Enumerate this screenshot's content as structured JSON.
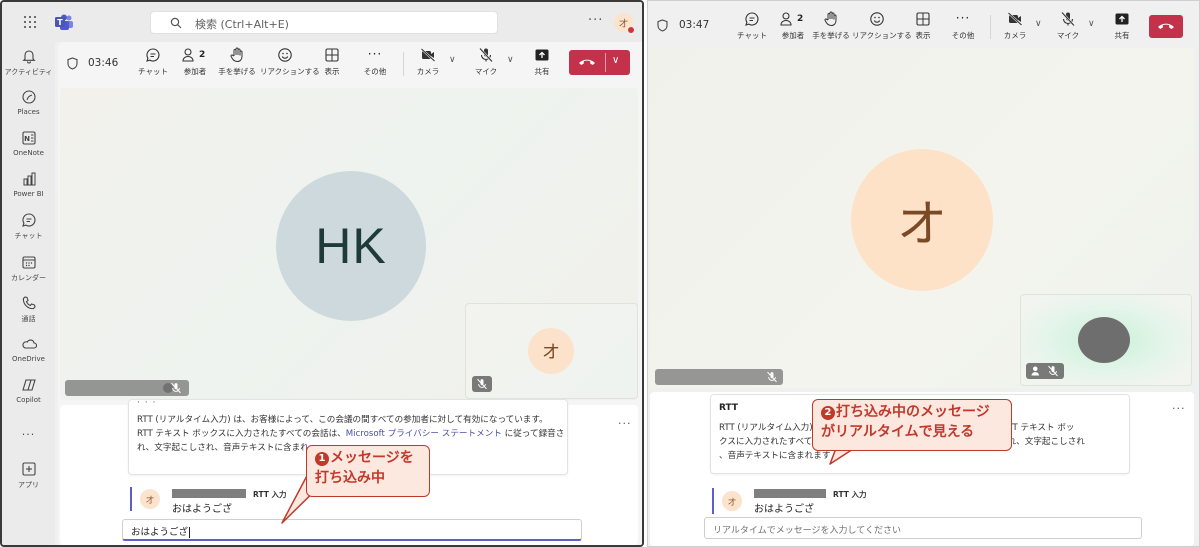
{
  "left": {
    "search_placeholder": "検索 (Ctrl+Alt+E)",
    "top_more": "···",
    "top_avatar": "オ",
    "rail": [
      {
        "label": "アクティビティ",
        "icon": "bell-icon"
      },
      {
        "label": "Places",
        "icon": "places-icon"
      },
      {
        "label": "OneNote",
        "icon": "onenote-icon"
      },
      {
        "label": "Power BI",
        "icon": "powerbi-icon"
      },
      {
        "label": "チャット",
        "icon": "chat-icon"
      },
      {
        "label": "カレンダー",
        "icon": "calendar-icon"
      },
      {
        "label": "通話",
        "icon": "phone-icon"
      },
      {
        "label": "OneDrive",
        "icon": "onedrive-icon"
      },
      {
        "label": "Copilot",
        "icon": "copilot-icon"
      },
      {
        "label": "···",
        "icon": "more-icon"
      },
      {
        "label": "アプリ",
        "icon": "apps-icon"
      }
    ],
    "timer": "03:46",
    "toolbar": {
      "chat": "チャット",
      "participants": "参加者",
      "participants_count": "2",
      "raise_hand": "手を挙げる",
      "reactions": "リアクションする",
      "view": "表示",
      "more": "その他",
      "camera": "カメラ",
      "mic": "マイク",
      "share": "共有"
    },
    "main_avatar": "HK",
    "pip_avatar": "オ",
    "info_text_1": "RTT (リアルタイム入力) は、お客様によって、この会議の間すべての参加者に対して有効になっています。",
    "info_text_2a": "RTT テキスト ボックスに入力されたすべての会話は、",
    "info_link": "Microsoft プライバシー ステートメント",
    "info_text_2b": " に従って録音さ",
    "info_text_3": "れ、文字起こしされ、音声テキストに含まれ",
    "panel_more": "···",
    "rtt_avatar": "オ",
    "rtt_label": "RTT 入力",
    "rtt_message": "おはようござ",
    "input_value": "おはようござ"
  },
  "callout1": {
    "num": "1",
    "line1": "メッセージを",
    "line2": "打ち込み中"
  },
  "callout2": {
    "num": "2",
    "line1": "打ち込み中のメッセージ",
    "line2": "がリアルタイムで見える"
  },
  "right": {
    "timer": "03:47",
    "toolbar": {
      "chat": "チャット",
      "participants": "参加者",
      "participants_count": "2",
      "raise_hand": "手を挙げる",
      "reactions": "リアクションする",
      "view": "表示",
      "more": "その他",
      "camera": "カメラ",
      "mic": "マイク",
      "share": "共有"
    },
    "main_avatar": "オ",
    "rtt_title": "RTT",
    "info_text_1a": "RTT (リアルタイム入力) は",
    "info_text_1b": "ています。RTT テキスト ボッ",
    "info_text_2a": "クスに入力されたすべての",
    "info_text_2b": "って録音され、文字起こしされ",
    "info_text_3": "、音声テキストに含まれます",
    "panel_more": "···",
    "rtt_avatar": "オ",
    "rtt_label": "RTT 入力",
    "rtt_message": "おはようござ",
    "input_placeholder": "リアルタイムでメッセージを入力してください"
  },
  "colors": {
    "hangup": "#c4314b",
    "accent": "#5b5fc7",
    "callout": "#c0392b",
    "callout_bg": "#fde8e0",
    "hk_avatar_bg": "#cfd8dc",
    "o_avatar_bg": "#fde2c8"
  }
}
